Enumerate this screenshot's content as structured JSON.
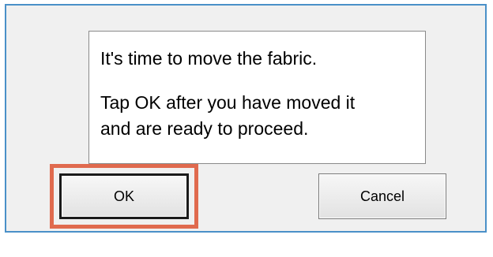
{
  "dialog": {
    "message_lines": [
      "It's time to move the fabric.",
      "Tap OK after you have moved it",
      "and are ready to proceed."
    ],
    "buttons": {
      "ok_label": "OK",
      "cancel_label": "Cancel"
    },
    "highlight_color": "#e06a4e",
    "border_color": "#4a90c8"
  }
}
